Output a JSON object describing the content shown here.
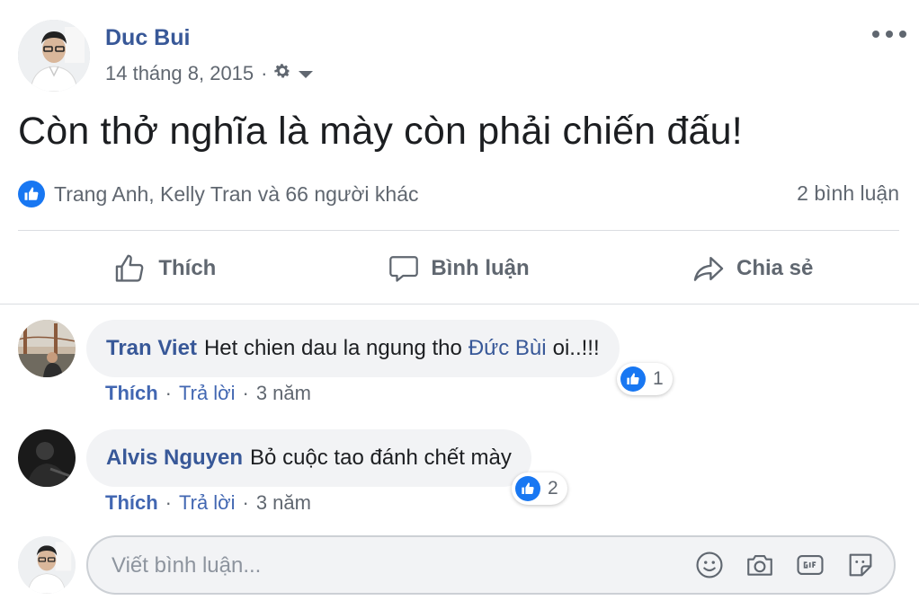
{
  "post": {
    "author": "Duc Bui",
    "date": "14 tháng 8, 2015",
    "separator": "·",
    "text": "Còn thở nghĩa là mày còn phải chiến đấu!",
    "reactions_text": "Trang Anh, Kelly Tran và 66 người khác",
    "comment_count": "2 bình luận",
    "icons": {
      "privacy": "gear-icon",
      "dropdown": "caret-down-icon",
      "more": "more-dots-icon"
    }
  },
  "actions": {
    "like": "Thích",
    "comment": "Bình luận",
    "share": "Chia sẻ"
  },
  "comments": [
    {
      "author": "Tran Viet",
      "text_before": "Het chien dau la ngung tho",
      "mention": "Đức Bùi",
      "text_after": "oi..!!!",
      "likes": "1",
      "like_label": "Thích",
      "reply_label": "Trả lời",
      "time": "3 năm",
      "separator": "·"
    },
    {
      "author": "Alvis Nguyen",
      "text_before": "Bỏ cuộc tao đánh chết mày",
      "likes": "2",
      "like_label": "Thích",
      "reply_label": "Trả lời",
      "time": "3 năm",
      "separator": "·"
    }
  ],
  "composer": {
    "placeholder": "Viết bình luận...",
    "icons": [
      "emoji-icon",
      "camera-icon",
      "gif-icon",
      "sticker-icon"
    ]
  },
  "colors": {
    "link": "#385898",
    "accent": "#1877f2",
    "muted": "#606770",
    "bubble_bg": "#f2f3f5"
  }
}
